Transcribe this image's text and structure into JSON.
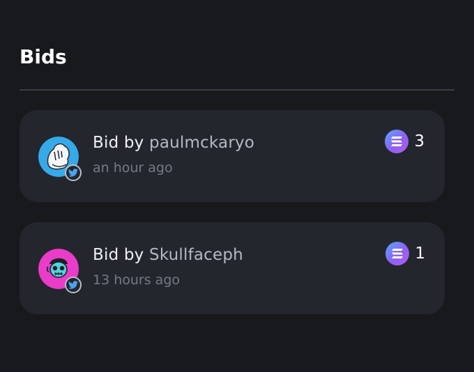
{
  "section": {
    "title": "Bids"
  },
  "bids": [
    {
      "prefix": "Bid by ",
      "bidder": "paulmckaryo",
      "time": "an hour ago",
      "amount": "3",
      "token_icon": "solana-icon",
      "social_icon": "twitter-icon",
      "avatar_color": "#36a9e9"
    },
    {
      "prefix": "Bid by ",
      "bidder": "Skullfaceph",
      "time": "13 hours ago",
      "amount": "1",
      "token_icon": "solana-icon",
      "social_icon": "twitter-icon",
      "avatar_color": "#ea3cc8"
    }
  ],
  "colors": {
    "background": "#18191d",
    "card": "#24262e",
    "divider": "#3a3c47",
    "text_primary": "#eef0f4",
    "text_secondary": "#b6b9c4",
    "text_muted": "#767a86"
  }
}
